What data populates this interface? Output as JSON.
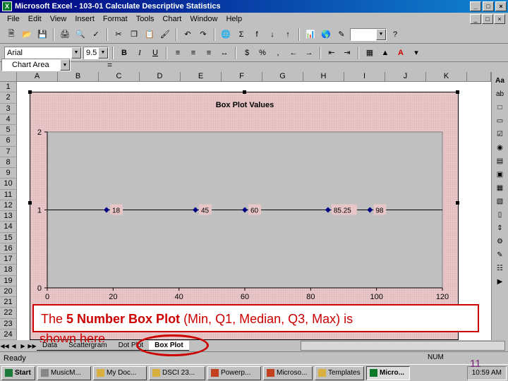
{
  "window": {
    "title": "Microsoft Excel - 103-01 Calculate Descriptive Statistics",
    "app_icon": "excel-icon",
    "buttons": [
      "_",
      "□",
      "×"
    ]
  },
  "menu": [
    "File",
    "Edit",
    "View",
    "Insert",
    "Format",
    "Tools",
    "Chart",
    "Window",
    "Help"
  ],
  "toolbar2": {
    "font_name": "Arial",
    "font_size": "9.5",
    "bold": "B",
    "italic": "I",
    "underline": "U",
    "percent": "%",
    "comma": ","
  },
  "formula_bar": {
    "name_box": "Chart Area",
    "equals": "="
  },
  "columns": [
    "A",
    "B",
    "C",
    "D",
    "E",
    "F",
    "G",
    "H",
    "I",
    "J",
    "K"
  ],
  "rows": [
    "1",
    "2",
    "3",
    "4",
    "5",
    "6",
    "7",
    "8",
    "9",
    "10",
    "11",
    "12",
    "13",
    "14",
    "15",
    "16",
    "17",
    "18",
    "19",
    "20",
    "21",
    "22",
    "23",
    "24"
  ],
  "right_panel_labels": [
    "Aa",
    "ab"
  ],
  "sheet_tabs": [
    "Data",
    "Scattergram",
    "Dot Plot",
    "Box Plot"
  ],
  "active_tab": "Box Plot",
  "status": {
    "ready": "Ready",
    "num": "NUM"
  },
  "taskbar": {
    "start": "Start",
    "items": [
      "MusicM...",
      "My Doc...",
      "DSCI 23...",
      "Powerp...",
      "Microso...",
      "Templates",
      "Micro..."
    ],
    "active_item": "Micro...",
    "clock": "10:59 AM"
  },
  "callout": {
    "prefix": "The ",
    "bold": "5 Number Box Plot",
    "rest": " (Min, Q1, Median, Q3, Max) is",
    "line2": "shown here"
  },
  "slide_number": "11",
  "colors": {
    "title_bar": "#000080",
    "chart_bg": "#e8c6c8",
    "plot_bg": "#c0c0c0",
    "series": "#000080",
    "callout": "#cc0000"
  },
  "chart_data": {
    "type": "scatter",
    "title": "Box Plot Values",
    "xlim": [
      0,
      120
    ],
    "ylim": [
      0,
      2
    ],
    "x_ticks": [
      0,
      20,
      40,
      60,
      80,
      100,
      120
    ],
    "y_ticks": [
      0,
      1,
      2
    ],
    "grid": false,
    "points": [
      {
        "x": 18,
        "y": 1,
        "label": "18"
      },
      {
        "x": 45,
        "y": 1,
        "label": "45"
      },
      {
        "x": 60,
        "y": 1,
        "label": "60"
      },
      {
        "x": 85.25,
        "y": 1,
        "label": "85.25"
      },
      {
        "x": 98,
        "y": 1,
        "label": "98"
      }
    ]
  }
}
